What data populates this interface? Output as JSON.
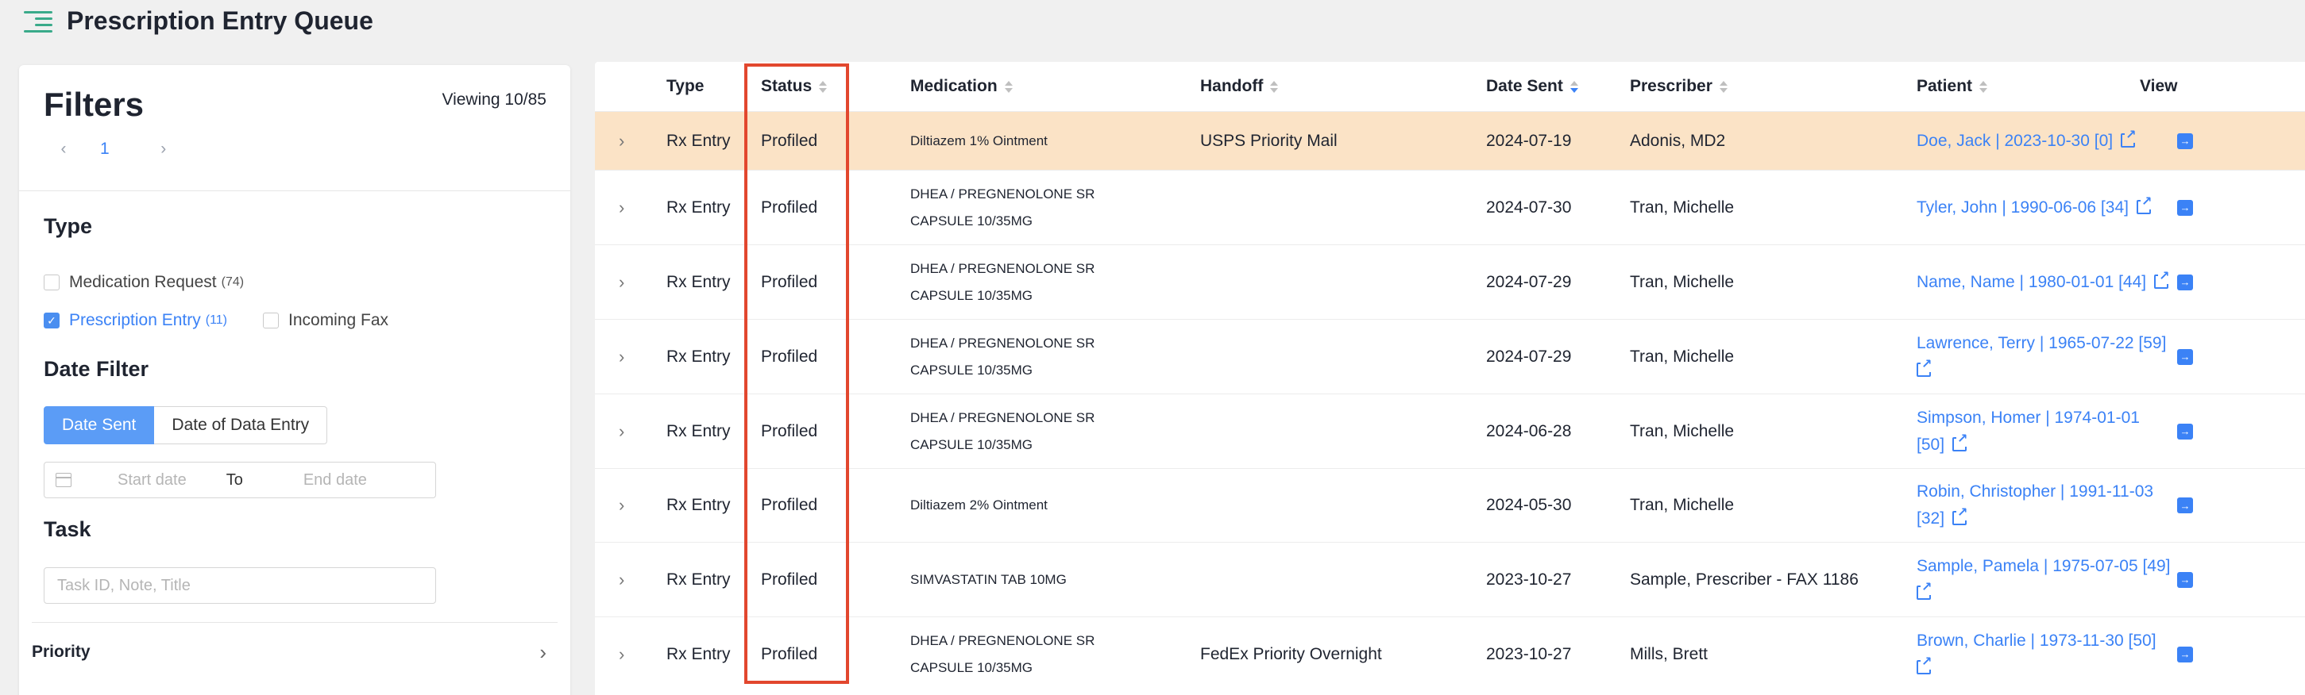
{
  "header": {
    "title": "Prescription Entry Queue",
    "menu_icon": "menu-icon"
  },
  "filters": {
    "title": "Filters",
    "viewing": "Viewing 10/85",
    "pager": {
      "current": "1",
      "prev_icon": "‹",
      "next_icon": "›"
    },
    "type": {
      "title": "Type",
      "options": [
        {
          "label": "Medication Request",
          "count": "(74)",
          "checked": false
        },
        {
          "label": "Prescription Entry",
          "count": "(11)",
          "checked": true
        },
        {
          "label": "Incoming Fax",
          "count": "",
          "checked": false
        }
      ]
    },
    "date_filter": {
      "title": "Date Filter",
      "tabs": [
        "Date Sent",
        "Date of Data Entry"
      ],
      "active_tab": "Date Sent",
      "start_placeholder": "Start date",
      "to_label": "To",
      "end_placeholder": "End date"
    },
    "task": {
      "title": "Task",
      "placeholder": "Task ID, Note, Title"
    },
    "priority": {
      "label": "Priority",
      "chevron": "›"
    }
  },
  "table": {
    "headers": {
      "type": "Type",
      "status": "Status",
      "medication": "Medication",
      "handoff": "Handoff",
      "date_sent": "Date Sent",
      "prescriber": "Prescriber",
      "patient": "Patient",
      "view": "View"
    },
    "sort_active": "Date Sent",
    "sort_direction": "descending",
    "highlight_color": "#fbe3c6",
    "rows": [
      {
        "expand": "›",
        "type": "Rx Entry",
        "status": "Profiled",
        "med1": "Diltiazem 1% Ointment",
        "med2": "",
        "handoff": "USPS Priority Mail",
        "date": "2024-07-19",
        "prescriber": "Adonis, MD2",
        "patient1": "Doe, Jack | 2023-10-30 [0]",
        "patient2": "",
        "view": "→",
        "highlight": true
      },
      {
        "expand": "›",
        "type": "Rx Entry",
        "status": "Profiled",
        "med1": "DHEA / PREGNENOLONE SR",
        "med2": "CAPSULE 10/35MG",
        "handoff": "",
        "date": "2024-07-30",
        "prescriber": "Tran, Michelle",
        "patient1": "Tyler, John | 1990-06-06 [34]",
        "patient2": "",
        "view": "→",
        "highlight": false
      },
      {
        "expand": "›",
        "type": "Rx Entry",
        "status": "Profiled",
        "med1": "DHEA / PREGNENOLONE SR",
        "med2": "CAPSULE 10/35MG",
        "handoff": "",
        "date": "2024-07-29",
        "prescriber": "Tran, Michelle",
        "patient1": "Name, Name | 1980-01-01 [44]",
        "patient2": "",
        "view": "→",
        "highlight": false
      },
      {
        "expand": "›",
        "type": "Rx Entry",
        "status": "Profiled",
        "med1": "DHEA / PREGNENOLONE SR",
        "med2": "CAPSULE 10/35MG",
        "handoff": "",
        "date": "2024-07-29",
        "prescriber": "Tran, Michelle",
        "patient1": "Lawrence, Terry | 1965-07-22 [59]",
        "patient2": " ",
        "view": "→",
        "highlight": false
      },
      {
        "expand": "›",
        "type": "Rx Entry",
        "status": "Profiled",
        "med1": "DHEA / PREGNENOLONE SR",
        "med2": "CAPSULE 10/35MG",
        "handoff": "",
        "date": "2024-06-28",
        "prescriber": "Tran, Michelle",
        "patient1": "Simpson, Homer | 1974-01-01",
        "patient2": "[50]",
        "view": "→",
        "highlight": false
      },
      {
        "expand": "›",
        "type": "Rx Entry",
        "status": "Profiled",
        "med1": "Diltiazem 2% Ointment",
        "med2": "",
        "handoff": "",
        "date": "2024-05-30",
        "prescriber": "Tran, Michelle",
        "patient1": "Robin, Christopher | 1991-11-03",
        "patient2": "[32]",
        "view": "→",
        "highlight": false
      },
      {
        "expand": "›",
        "type": "Rx Entry",
        "status": "Profiled",
        "med1": "SIMVASTATIN TAB 10MG",
        "med2": "",
        "handoff": "",
        "date": "2023-10-27",
        "prescriber": "Sample, Prescriber - FAX 1186",
        "patient1": "Sample, Pamela | 1975-07-05 [49]",
        "patient2": " ",
        "view": "→",
        "highlight": false
      },
      {
        "expand": "›",
        "type": "Rx Entry",
        "status": "Profiled",
        "med1": "DHEA / PREGNENOLONE SR",
        "med2": "CAPSULE 10/35MG",
        "handoff": "FedEx Priority Overnight",
        "date": "2023-10-27",
        "prescriber": "Mills, Brett",
        "patient1": "Brown, Charlie | 1973-11-30 [50]",
        "patient2": " ",
        "view": "→",
        "highlight": false
      }
    ]
  }
}
